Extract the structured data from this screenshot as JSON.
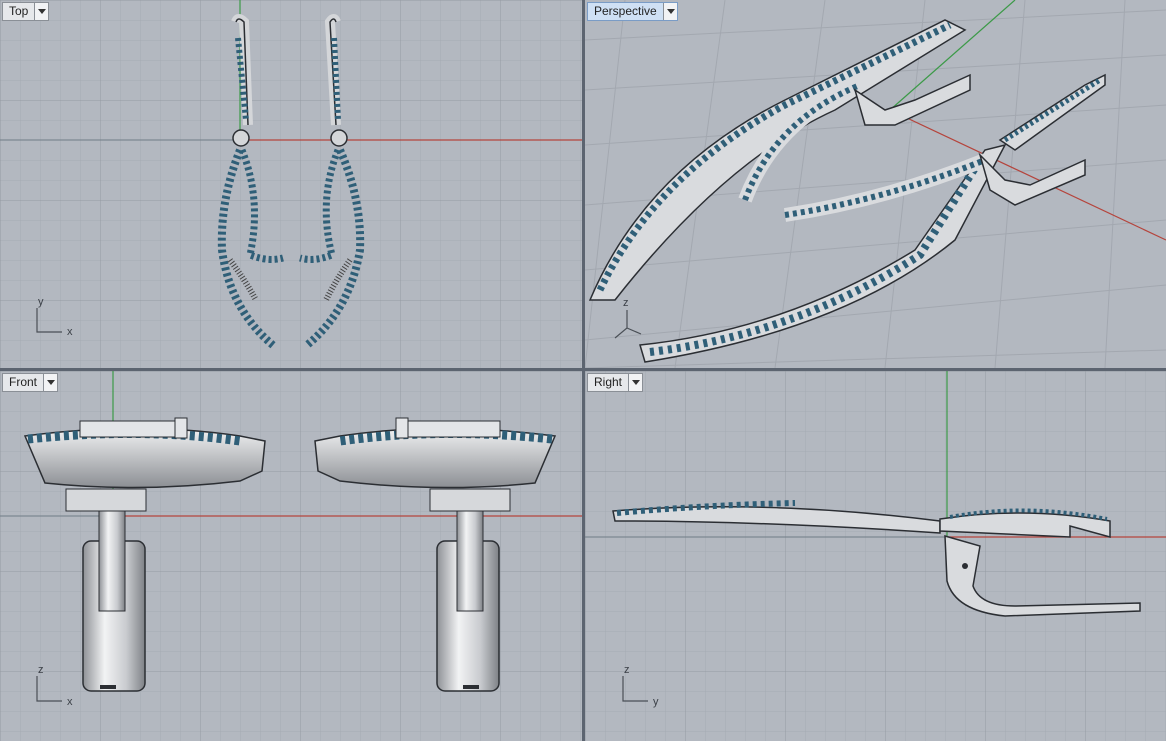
{
  "viewports": {
    "top": {
      "title": "Top",
      "axis_h": "x",
      "axis_v": "y"
    },
    "perspective": {
      "title": "Perspective",
      "axis_v": "z"
    },
    "front": {
      "title": "Front",
      "axis_h": "x",
      "axis_v": "z"
    },
    "right": {
      "title": "Right",
      "axis_h": "y",
      "axis_v": "z"
    }
  },
  "colors": {
    "viewport_bg": "#b3b8c0",
    "grid_minor": "#a6abb3",
    "grid_major": "#959aa2",
    "axis_x": "#b5443c",
    "axis_y": "#3c9a48",
    "metal": "#d9dbde",
    "metal_edge": "#2b2e33",
    "gem": "#2f5f78",
    "active_tab": "#cfe0f4"
  },
  "icons": [
    "dropdown-arrow-icon",
    "axis-widget-icon"
  ]
}
